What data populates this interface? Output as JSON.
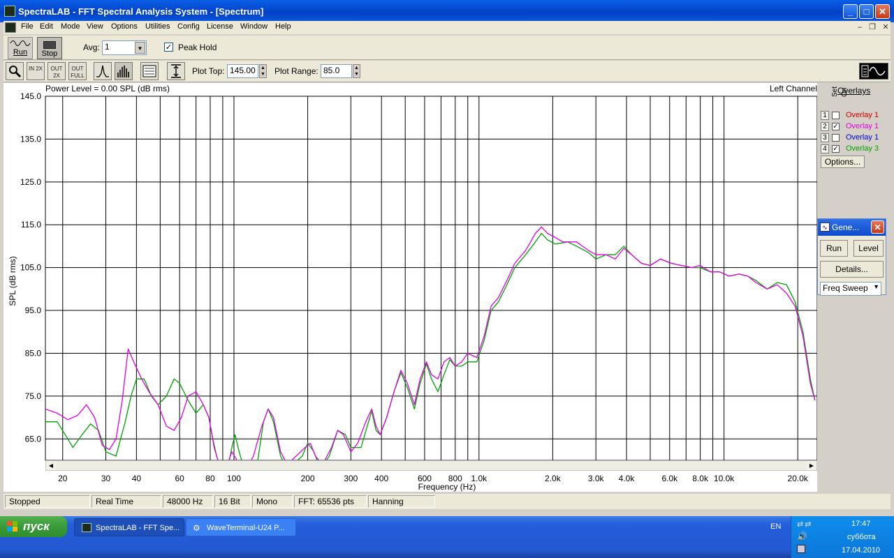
{
  "window": {
    "title": "SpectraLAB - FFT Spectral Analysis System - [Spectrum]"
  },
  "menu": [
    "File",
    "Edit",
    "Mode",
    "View",
    "Options",
    "Utilities",
    "Config",
    "License",
    "Window",
    "Help"
  ],
  "toolbar": {
    "run_label": "Run",
    "stop_label": "Stop",
    "avg_label": "Avg:",
    "avg_value": "1",
    "peak_hold_label": "Peak Hold",
    "peak_hold_checked": true,
    "plot_top_label": "Plot Top:",
    "plot_top_value": "145.00",
    "plot_range_label": "Plot Range:",
    "plot_range_value": "85.0",
    "icon_buttons": [
      "zoom-icon",
      "zoom-in-2x-icon",
      "zoom-out-2x-icon",
      "zoom-out-full-icon",
      "line-mode-icon",
      "bar-mode-icon",
      "settings-panel-icon",
      "vertical-cursor-icon"
    ],
    "zoom_in_label": "IN 2X",
    "zoom_out_label": "OUT 2X",
    "zoom_full_label": "OUT FULL"
  },
  "plot": {
    "power_level": "Power Level = 0.00 SPL (dB rms)",
    "channel": "Left Channel",
    "ylabel": "SPL (dB rms)",
    "xlabel": "Frequency (Hz)"
  },
  "chart_data": {
    "type": "line",
    "x_scale": "log",
    "xlim": [
      17,
      24000
    ],
    "ylim": [
      60,
      145
    ],
    "grid": true,
    "ylabel": "SPL (dB rms)",
    "xlabel": "Frequency (Hz)",
    "y_ticks": [
      "145.0",
      "135.0",
      "125.0",
      "115.0",
      "105.0",
      "95.0",
      "85.0",
      "75.0",
      "65.0"
    ],
    "x_ticks": [
      {
        "f": 20,
        "label": "20"
      },
      {
        "f": 30,
        "label": "30"
      },
      {
        "f": 40,
        "label": "40"
      },
      {
        "f": 60,
        "label": "60"
      },
      {
        "f": 80,
        "label": "80"
      },
      {
        "f": 100,
        "label": "100"
      },
      {
        "f": 200,
        "label": "200"
      },
      {
        "f": 300,
        "label": "300"
      },
      {
        "f": 400,
        "label": "400"
      },
      {
        "f": 600,
        "label": "600"
      },
      {
        "f": 800,
        "label": "800"
      },
      {
        "f": 1000,
        "label": "1.0k"
      },
      {
        "f": 2000,
        "label": "2.0k"
      },
      {
        "f": 3000,
        "label": "3.0k"
      },
      {
        "f": 4000,
        "label": "4.0k"
      },
      {
        "f": 6000,
        "label": "6.0k"
      },
      {
        "f": 8000,
        "label": "8.0k"
      },
      {
        "f": 10000,
        "label": "10.0k"
      },
      {
        "f": 20000,
        "label": "20.0k"
      }
    ],
    "grid_x": [
      20,
      30,
      40,
      50,
      60,
      70,
      80,
      90,
      100,
      200,
      300,
      400,
      500,
      600,
      700,
      800,
      900,
      1000,
      2000,
      3000,
      4000,
      5000,
      6000,
      7000,
      8000,
      9000,
      10000,
      20000
    ],
    "series": [
      {
        "name": "Overlay 1",
        "color": "#e000e0",
        "points": [
          [
            17,
            72
          ],
          [
            19,
            71
          ],
          [
            21,
            69.5
          ],
          [
            23,
            70.5
          ],
          [
            25,
            73
          ],
          [
            27,
            70
          ],
          [
            29,
            63.5
          ],
          [
            31,
            62.5
          ],
          [
            33,
            65
          ],
          [
            35,
            74
          ],
          [
            37,
            86
          ],
          [
            39,
            83
          ],
          [
            42,
            79
          ],
          [
            45,
            76
          ],
          [
            49,
            73
          ],
          [
            53,
            68
          ],
          [
            57,
            67
          ],
          [
            61,
            70
          ],
          [
            65,
            75
          ],
          [
            70,
            76
          ],
          [
            75,
            73
          ],
          [
            79,
            70
          ],
          [
            83,
            63
          ],
          [
            87,
            59
          ],
          [
            94,
            59
          ],
          [
            98,
            62
          ],
          [
            103,
            60
          ],
          [
            108,
            59
          ],
          [
            115,
            59
          ],
          [
            120,
            61
          ],
          [
            130,
            68
          ],
          [
            138,
            72
          ],
          [
            145,
            70
          ],
          [
            155,
            62
          ],
          [
            165,
            59
          ],
          [
            195,
            63
          ],
          [
            205,
            64
          ],
          [
            215,
            61
          ],
          [
            230,
            59
          ],
          [
            250,
            63
          ],
          [
            265,
            67
          ],
          [
            280,
            66
          ],
          [
            300,
            62
          ],
          [
            320,
            64
          ],
          [
            345,
            69
          ],
          [
            365,
            72
          ],
          [
            380,
            68
          ],
          [
            395,
            66
          ],
          [
            420,
            70
          ],
          [
            450,
            76
          ],
          [
            480,
            81
          ],
          [
            510,
            78
          ],
          [
            545,
            73
          ],
          [
            575,
            79
          ],
          [
            610,
            83
          ],
          [
            640,
            80
          ],
          [
            680,
            79
          ],
          [
            720,
            83
          ],
          [
            760,
            84
          ],
          [
            800,
            82
          ],
          [
            850,
            83
          ],
          [
            900,
            85
          ],
          [
            980,
            84
          ],
          [
            1050,
            89
          ],
          [
            1120,
            96
          ],
          [
            1200,
            98
          ],
          [
            1300,
            102
          ],
          [
            1400,
            106
          ],
          [
            1550,
            109
          ],
          [
            1700,
            113
          ],
          [
            1800,
            114.5
          ],
          [
            1900,
            113
          ],
          [
            2050,
            112
          ],
          [
            2200,
            111
          ],
          [
            2500,
            111
          ],
          [
            2800,
            109
          ],
          [
            3000,
            108
          ],
          [
            3300,
            108
          ],
          [
            3600,
            107
          ],
          [
            3900,
            109.5
          ],
          [
            4200,
            108
          ],
          [
            4600,
            106
          ],
          [
            5000,
            105.5
          ],
          [
            5500,
            107
          ],
          [
            6100,
            106
          ],
          [
            6700,
            105.5
          ],
          [
            7400,
            105
          ],
          [
            8000,
            105.5
          ],
          [
            8800,
            104
          ],
          [
            9600,
            104
          ],
          [
            10500,
            103
          ],
          [
            11500,
            103.5
          ],
          [
            12500,
            103
          ],
          [
            13500,
            101.5
          ],
          [
            15000,
            100
          ],
          [
            16500,
            101
          ],
          [
            18000,
            99
          ],
          [
            19500,
            96
          ],
          [
            21000,
            89
          ],
          [
            22500,
            78
          ],
          [
            23500,
            74
          ]
        ]
      },
      {
        "name": "Overlay 3",
        "color": "#00a000",
        "points": [
          [
            17,
            69
          ],
          [
            19,
            69
          ],
          [
            21,
            65
          ],
          [
            22,
            63
          ],
          [
            24,
            66
          ],
          [
            26,
            68.5
          ],
          [
            28,
            67
          ],
          [
            30,
            62
          ],
          [
            33,
            61
          ],
          [
            36,
            69
          ],
          [
            38,
            75
          ],
          [
            40,
            79
          ],
          [
            43,
            79
          ],
          [
            46,
            75
          ],
          [
            49,
            73
          ],
          [
            53,
            75
          ],
          [
            57,
            79
          ],
          [
            60,
            78
          ],
          [
            65,
            74
          ],
          [
            70,
            71
          ],
          [
            75,
            73
          ],
          [
            79,
            70
          ],
          [
            82,
            65
          ],
          [
            85,
            61
          ],
          [
            88,
            58
          ],
          [
            95,
            59
          ],
          [
            98,
            63
          ],
          [
            101,
            66
          ],
          [
            105,
            62
          ],
          [
            110,
            58
          ],
          [
            118,
            58
          ],
          [
            125,
            60
          ],
          [
            132,
            69
          ],
          [
            138,
            72
          ],
          [
            145,
            69
          ],
          [
            155,
            61
          ],
          [
            165,
            58
          ],
          [
            190,
            61
          ],
          [
            200,
            64
          ],
          [
            212,
            62
          ],
          [
            225,
            58
          ],
          [
            245,
            61
          ],
          [
            265,
            67
          ],
          [
            285,
            66
          ],
          [
            300,
            63
          ],
          [
            330,
            63
          ],
          [
            350,
            68
          ],
          [
            365,
            71.5
          ],
          [
            380,
            67
          ],
          [
            395,
            66
          ],
          [
            420,
            70
          ],
          [
            450,
            76
          ],
          [
            480,
            80.5
          ],
          [
            510,
            77
          ],
          [
            545,
            72
          ],
          [
            575,
            78
          ],
          [
            610,
            82.5
          ],
          [
            640,
            79
          ],
          [
            680,
            76
          ],
          [
            720,
            80
          ],
          [
            760,
            83.5
          ],
          [
            800,
            82
          ],
          [
            850,
            82
          ],
          [
            900,
            83
          ],
          [
            980,
            83
          ],
          [
            1050,
            88
          ],
          [
            1120,
            95
          ],
          [
            1200,
            97
          ],
          [
            1300,
            101
          ],
          [
            1400,
            105
          ],
          [
            1550,
            108
          ],
          [
            1700,
            111
          ],
          [
            1800,
            113
          ],
          [
            1900,
            111.5
          ],
          [
            2050,
            110.5
          ],
          [
            2300,
            111
          ],
          [
            2500,
            110
          ],
          [
            2800,
            108.5
          ],
          [
            3000,
            107
          ],
          [
            3300,
            108
          ],
          [
            3600,
            108
          ],
          [
            3900,
            110
          ],
          [
            4200,
            108
          ],
          [
            4600,
            106
          ],
          [
            5000,
            105.5
          ],
          [
            5500,
            107
          ],
          [
            6100,
            106
          ],
          [
            6700,
            105.5
          ],
          [
            7400,
            105
          ],
          [
            8000,
            105
          ],
          [
            8800,
            104
          ],
          [
            9600,
            104
          ],
          [
            10500,
            103
          ],
          [
            11500,
            103.5
          ],
          [
            12500,
            103
          ],
          [
            13500,
            102
          ],
          [
            15000,
            100
          ],
          [
            16500,
            101.5
          ],
          [
            18000,
            101
          ],
          [
            19500,
            97
          ],
          [
            21000,
            90
          ],
          [
            22500,
            79
          ],
          [
            23500,
            74
          ]
        ]
      }
    ]
  },
  "overlays": {
    "header": "Overlays",
    "col_set": "Set",
    "col_on": "On",
    "items": [
      {
        "num": "1",
        "checked": false,
        "name": "Overlay 1",
        "color": "#d00000"
      },
      {
        "num": "2",
        "checked": true,
        "name": "Overlay 1",
        "color": "#e000e0"
      },
      {
        "num": "3",
        "checked": false,
        "name": "Overlay 1",
        "color": "#0000d0"
      },
      {
        "num": "4",
        "checked": true,
        "name": "Overlay 3",
        "color": "#00a000"
      }
    ],
    "options_label": "Options..."
  },
  "generator": {
    "title": "Gene...",
    "run_label": "Run",
    "level_label": "Level",
    "details_label": "Details...",
    "mode_value": "Freq Sweep"
  },
  "status": [
    "Stopped",
    "Real Time",
    "48000 Hz",
    "16 Bit",
    "Mono",
    "FFT: 65536 pts",
    "Hanning"
  ],
  "taskbar": {
    "start_label": "пуск",
    "tasks": [
      "SpectraLAB - FFT Spe...",
      "WaveTerminal-U24 P..."
    ],
    "lang": "EN",
    "time": "17:47",
    "day": "суббота",
    "date": "17.04.2010"
  }
}
